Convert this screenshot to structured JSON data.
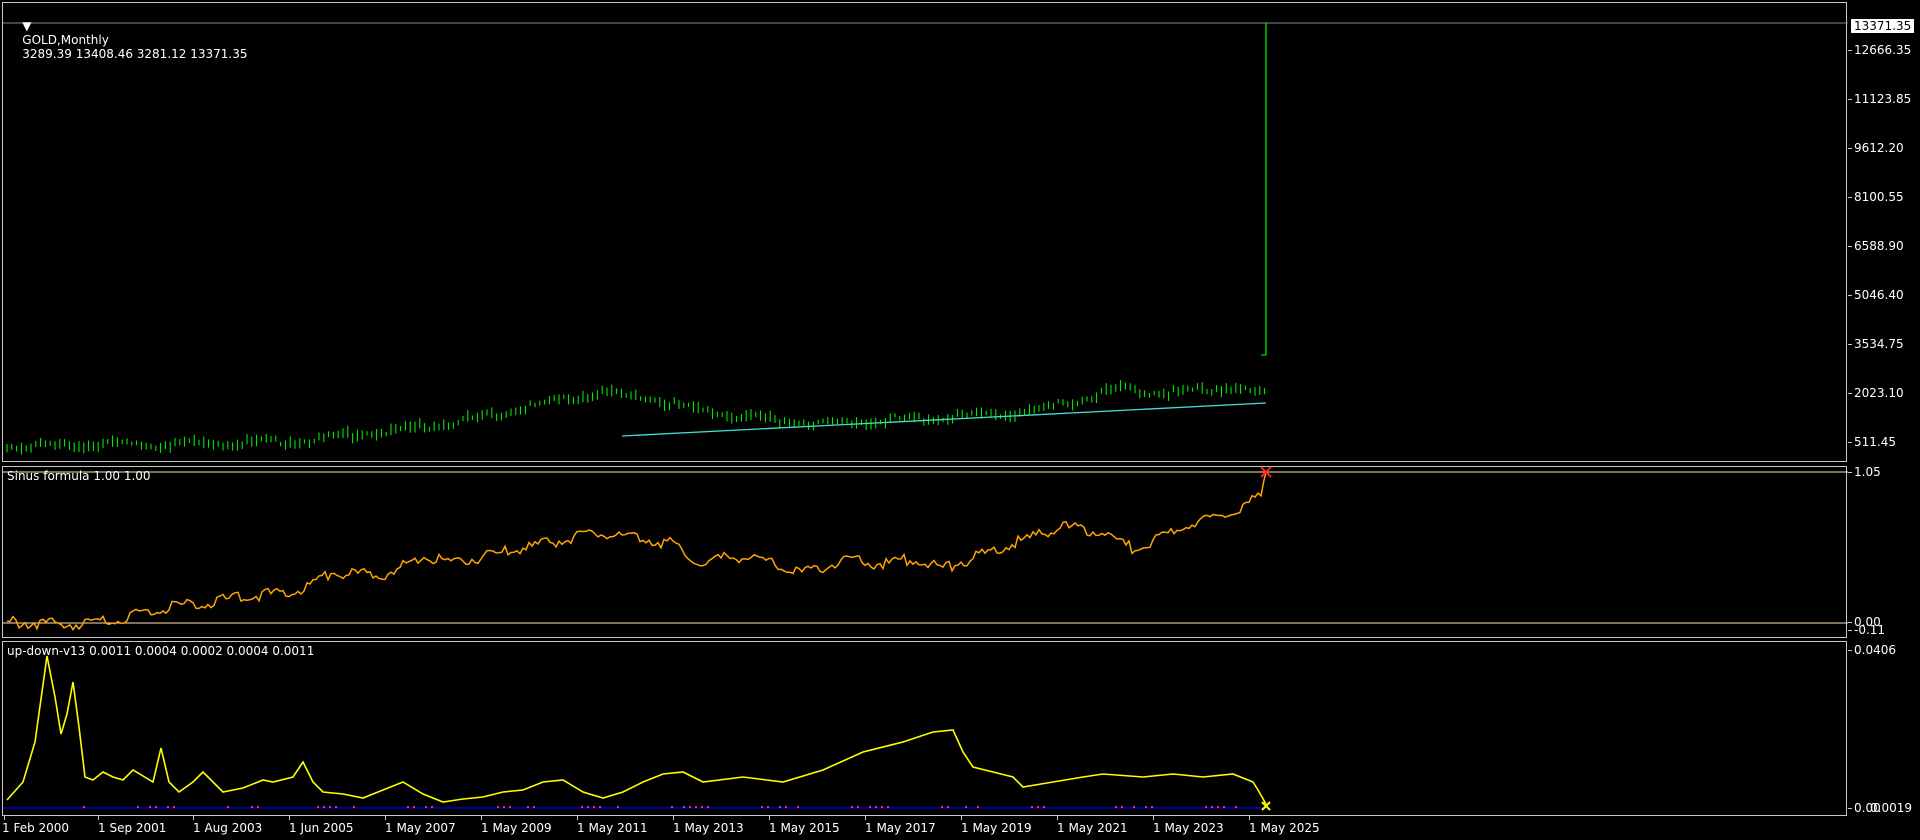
{
  "main": {
    "symbol_label": "GOLD,Monthly",
    "ohlc": "3289.39 13408.46 3281.12 13371.35",
    "current_price": "13371.35",
    "y_labels": [
      "12666.35",
      "11123.85",
      "9612.20",
      "8100.55",
      "6588.90",
      "5046.40",
      "3534.75",
      "2023.10",
      "511.45"
    ],
    "colors": {
      "candle": "#00ff00",
      "trend": "#40e0d0",
      "background": "#000000"
    }
  },
  "sinus": {
    "title": "Sinus formula 1.00 1.00",
    "y_labels": [
      "1.05",
      "0.00",
      "-0.11"
    ],
    "colors": {
      "line": "#ffa500",
      "marker": "#ff2020",
      "level": "#ffe4b5"
    }
  },
  "updown": {
    "title": "up-down-v13 0.0011 0.0004 0.0002 0.0004 0.0011",
    "y_labels": [
      "0.0406",
      "0.0019",
      "0.00"
    ],
    "colors": {
      "line": "#ffff00",
      "base": "#0000ff",
      "dots": "#ff3030",
      "marker": "#ffff00"
    }
  },
  "time_axis": {
    "labels": [
      "1 Feb 2000",
      "1 Sep 2001",
      "1 Aug 2003",
      "1 Jun 2005",
      "1 May 2007",
      "1 May 2009",
      "1 May 2011",
      "1 May 2013",
      "1 May 2015",
      "1 May 2017",
      "1 May 2019",
      "1 May 2021",
      "1 May 2023",
      "1 May 2025"
    ]
  }
}
